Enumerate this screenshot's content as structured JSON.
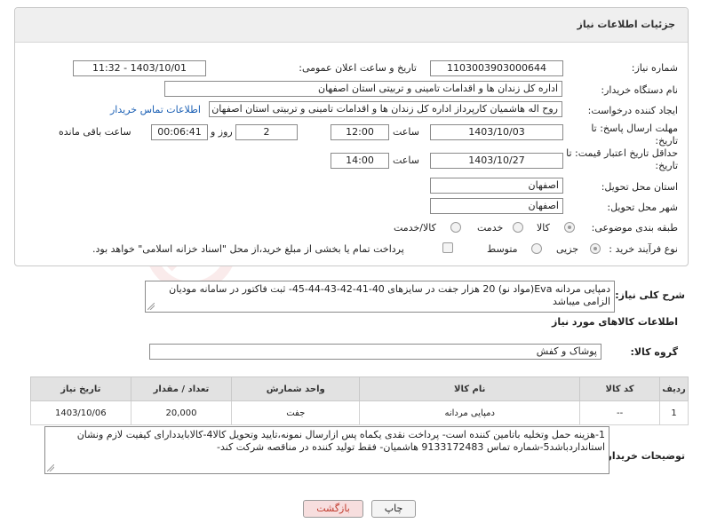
{
  "panel": {
    "title": "جزئیات اطلاعات نیاز"
  },
  "fields": {
    "need_number_label": "شماره نیاز:",
    "need_number": "1103003903000644",
    "announce_label": "تاریخ و ساعت اعلان عمومی:",
    "announce_value": "1403/10/01 - 11:32",
    "buyer_org_label": "نام دستگاه خریدار:",
    "buyer_org": "اداره کل زندان ها و اقدامات تامینی و تربیتی استان اصفهان",
    "requester_label": "ایجاد کننده درخواست:",
    "requester": "روح اله هاشمیان کارپرداز اداره کل زندان ها و اقدامات تامینی و تربیتی استان اصفهان",
    "contact_link": "اطلاعات تماس خریدار",
    "deadline_label_1": "مهلت ارسال پاسخ: تا",
    "deadline_label_2": "تاریخ:",
    "deadline_date": "1403/10/03",
    "time_label": "ساعت",
    "deadline_time": "12:00",
    "days_value": "2",
    "days_label": "روز و",
    "remaining_value": "00:06:41",
    "remaining_label": "ساعت باقی مانده",
    "validity_label_1": "حداقل تاریخ اعتبار قیمت: تا",
    "validity_label_2": "تاریخ:",
    "validity_date": "1403/10/27",
    "validity_time": "14:00",
    "province_label": "استان محل تحویل:",
    "province": "اصفهان",
    "city_label": "شهر محل تحویل:",
    "city": "اصفهان",
    "category_label": "طبقه بندی موضوعی:",
    "category_options": [
      "کالا",
      "خدمت",
      "کالا/خدمت"
    ],
    "purchase_label": "نوع فرآیند خرید :",
    "purchase_options": [
      "جزیی",
      "متوسط"
    ],
    "treasury_note": "پرداخت تمام یا بخشی از مبلغ خرید،از محل \"اسناد خزانه اسلامی\" خواهد بود."
  },
  "description": {
    "label": "شرح کلی نیاز:",
    "text": "دمپایی مردانه Eva(مواد نو) 20 هزار جفت در سایزهای 40-41-42-43-44-45- ثبت فاکتور در سامانه مودیان الزامی میباشد"
  },
  "goods_section": {
    "title": "اطلاعات کالاهای مورد نیاز"
  },
  "goods_group": {
    "label": "گروه کالا:",
    "value": "پوشاک و کفش"
  },
  "table": {
    "headers": [
      "ردیف",
      "کد کالا",
      "نام کالا",
      "واحد شمارش",
      "تعداد / مقدار",
      "تاریخ نیاز"
    ],
    "rows": [
      [
        "1",
        "--",
        "دمپایی مردانه",
        "جفت",
        "20,000",
        "1403/10/06"
      ]
    ]
  },
  "buyer_notes": {
    "label": "توضیحات خریدار:",
    "text": "1-هزینه حمل وتخلیه باتامین کننده است- پرداخت نقدی یکماه  پس ازارسال نمونه،تایید وتحویل کالا4-کالابایددارای کیفیت لازم ونشان استانداردباشد5-شماره تماس 9133172483 هاشمیان- فقط تولید کننده در مناقصه شرکت کند-"
  },
  "buttons": {
    "print": "چاپ",
    "back": "بازگشت"
  },
  "watermark": {
    "text": "AriaTender.neT"
  },
  "colors": {
    "link": "#1a5fb4",
    "back_button": "#f7dede",
    "back_text": "#c0392b"
  }
}
